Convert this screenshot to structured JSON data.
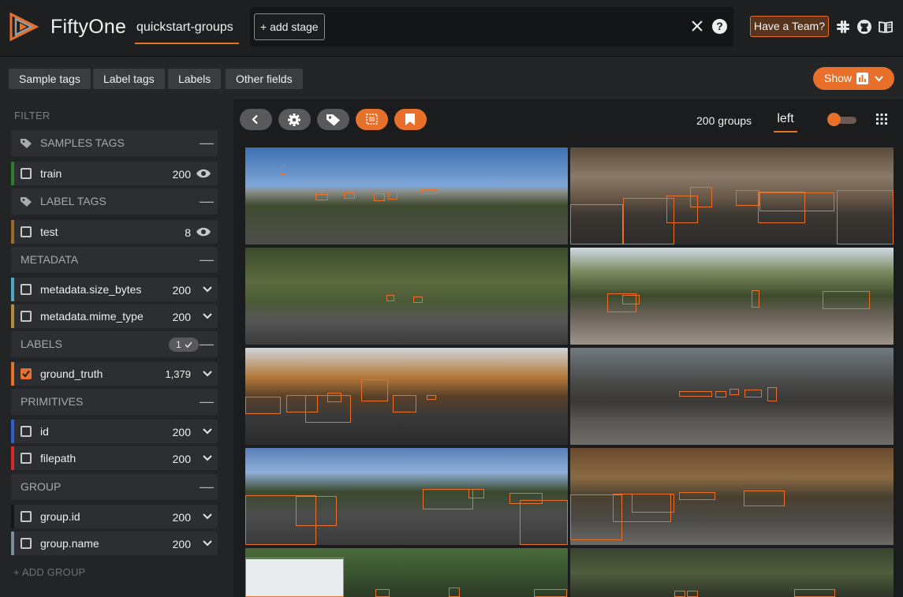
{
  "header": {
    "brand": "FiftyOne",
    "dataset": "quickstart-groups",
    "add_stage": "+ add stage",
    "help": "?",
    "team_button": "Have a Team?",
    "icons": [
      "slack-icon",
      "github-icon",
      "docs-book-icon"
    ]
  },
  "tagbar": {
    "buttons": [
      "Sample tags",
      "Label tags",
      "Labels",
      "Other fields"
    ],
    "show_button": "Show"
  },
  "sidebar": {
    "title": "FILTER",
    "groups": [
      {
        "label": "SAMPLES TAGS",
        "fields": [
          {
            "name": "train",
            "count": "200",
            "color": "#2f7d2f",
            "checked": false,
            "control": "eye"
          }
        ]
      },
      {
        "label": "LABEL TAGS",
        "fields": [
          {
            "name": "test",
            "count": "8",
            "color": "#9a6a2b",
            "checked": false,
            "control": "eye"
          }
        ]
      },
      {
        "label": "METADATA",
        "fields": [
          {
            "name": "metadata.size_bytes",
            "count": "200",
            "color": "#4ea8c4",
            "checked": false,
            "control": "chevron"
          },
          {
            "name": "metadata.mime_type",
            "count": "200",
            "color": "#b38b3d",
            "checked": false,
            "control": "chevron"
          }
        ]
      },
      {
        "label": "LABELS",
        "badge": "1",
        "fields": [
          {
            "name": "ground_truth",
            "count": "1,379",
            "color": "#e8702a",
            "checked": true,
            "control": "chevron"
          }
        ]
      },
      {
        "label": "PRIMITIVES",
        "fields": [
          {
            "name": "id",
            "count": "200",
            "color": "#2f5fce",
            "checked": false,
            "control": "chevron"
          },
          {
            "name": "filepath",
            "count": "200",
            "color": "#d42a2a",
            "checked": false,
            "control": "chevron"
          }
        ]
      },
      {
        "label": "GROUP",
        "fields": [
          {
            "name": "group.id",
            "count": "200",
            "color": "#161616",
            "checked": false,
            "control": "chevron"
          },
          {
            "name": "group.name",
            "count": "200",
            "color": "#7a8e9a",
            "checked": false,
            "control": "chevron"
          }
        ]
      }
    ],
    "add_group": "+ ADD GROUP"
  },
  "main": {
    "count_label": "200 groups",
    "slice": "left",
    "toolbar_icons": [
      "back-icon",
      "settings-icon",
      "tag-icon",
      "select-labels-icon",
      "bookmark-icon"
    ],
    "colors": {
      "accent": "#e8702a",
      "background": "#1b1c1e"
    }
  }
}
